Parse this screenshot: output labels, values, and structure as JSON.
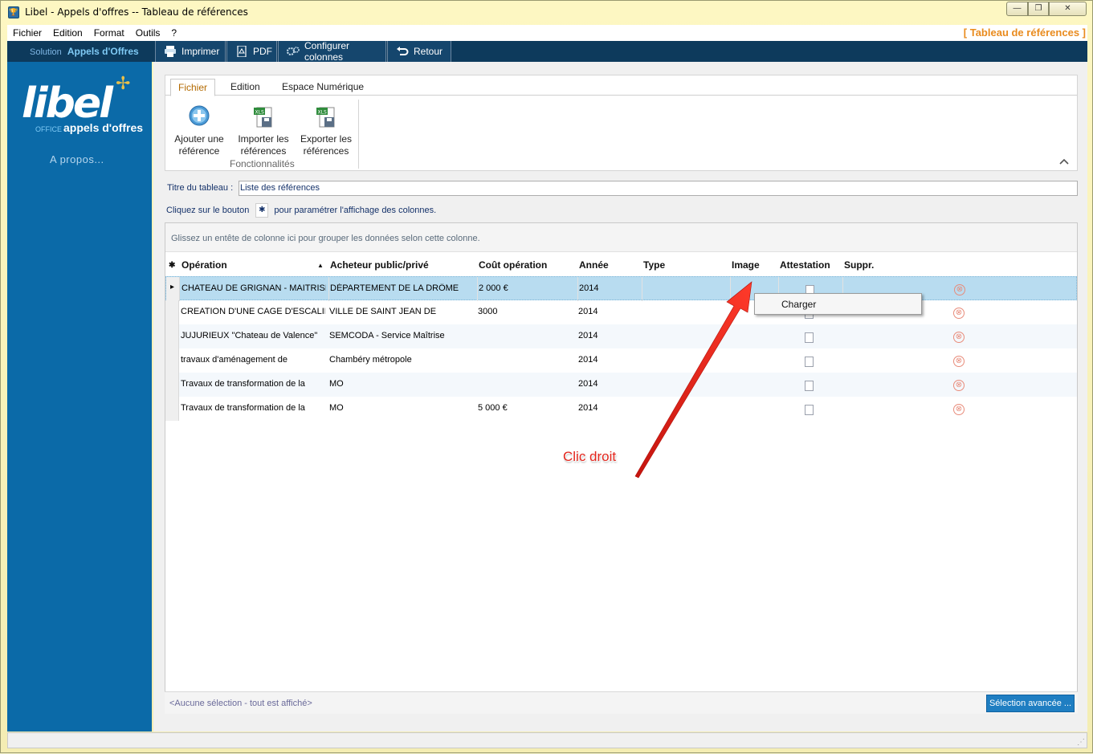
{
  "window": {
    "title": "Libel - Appels d'offres -- Tableau de références",
    "minimize": "—",
    "maximize": "❐",
    "close": "✕",
    "app_icon": "🏆"
  },
  "menubar": {
    "items": [
      "Fichier",
      "Edition",
      "Format",
      "Outils",
      "?"
    ],
    "breadcrumb": "[ Tableau de références ]"
  },
  "toolbar": {
    "solution_prefix": "Solution",
    "solution_name": "Appels d'Offres",
    "buttons": [
      "Imprimer",
      "PDF",
      "Configurer colonnes",
      "Retour"
    ]
  },
  "sidebar": {
    "logo_text": "libel",
    "logo_office": "OFFICE",
    "logo_sub": "appels d'offres",
    "about": "A propos..."
  },
  "ribbon": {
    "tabs": [
      "Fichier",
      "Edition",
      "Espace Numérique"
    ],
    "buttons": [
      {
        "line1": "Ajouter une",
        "line2": "référence",
        "icon": "add-circle-icon"
      },
      {
        "line1": "Importer les",
        "line2": "références",
        "icon": "xls-import-icon"
      },
      {
        "line1": "Exporter les",
        "line2": "références",
        "icon": "xls-export-icon"
      }
    ],
    "group_label": "Fonctionnalités",
    "collapse": "^"
  },
  "form": {
    "title_label": "Titre du tableau :",
    "title_value": "Liste des références",
    "hint_before": "Cliquez sur le bouton",
    "hint_button": "✱",
    "hint_after": "pour paramétrer l'affichage des colonnes."
  },
  "grid": {
    "group_hint": "Glissez un entête de colonne ici pour grouper les données selon cette colonne.",
    "corner_icon": "✱",
    "sort_icon": "▲",
    "columns": [
      "Opération",
      "Acheteur public/privé",
      "Coût opération",
      "Année",
      "Type",
      "Image",
      "Attestation",
      "Suppr."
    ],
    "rows": [
      {
        "operation": "CHATEAU DE GRIGNAN - MAITRISE",
        "acheteur": "DÉPARTEMENT DE LA DRÔME",
        "cout": "2 000 €",
        "annee": "2014",
        "type": "",
        "selected": true
      },
      {
        "operation": "CREATION D'UNE CAGE D'ESCALIER",
        "acheteur": "VILLE DE SAINT JEAN DE",
        "cout": "3000",
        "annee": "2014",
        "type": "",
        "selected": false
      },
      {
        "operation": "JUJURIEUX \"Chateau de Valence\"",
        "acheteur": "SEMCODA - Service Maîtrise",
        "cout": "",
        "annee": "2014",
        "type": "",
        "selected": false
      },
      {
        "operation": "travaux d'aménagement de",
        "acheteur": "Chambéry métropole",
        "cout": "",
        "annee": "2014",
        "type": "",
        "selected": false
      },
      {
        "operation": "Travaux de transformation de la",
        "acheteur": "MO",
        "cout": "",
        "annee": "2014",
        "type": "",
        "selected": false
      },
      {
        "operation": "Travaux de transformation de la",
        "acheteur": "MO",
        "cout": "5 000 €",
        "annee": "2014",
        "type": "",
        "selected": false
      }
    ],
    "delete_icon": "⊗"
  },
  "context_menu": {
    "items": [
      "Charger"
    ]
  },
  "annotation": {
    "text": "Clic droit",
    "color": "#e3241b"
  },
  "footer": {
    "status": "<Aucune sélection - tout est affiché>",
    "advanced_button": "Sélection avancée ..."
  },
  "colors": {
    "toolbar_bg": "#0d3a5c",
    "sidebar_bg": "#0b6aa8",
    "accent_orange": "#e98b1e",
    "selection": "#b8dcf0"
  }
}
